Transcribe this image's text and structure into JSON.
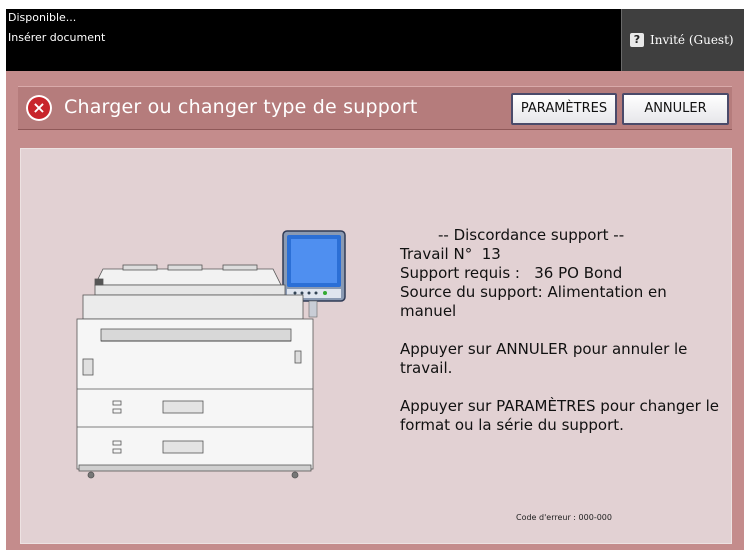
{
  "status": {
    "line1": "Disponible...",
    "line2": "Insérer document",
    "user_label": "Invité (Guest)",
    "user_icon": "?"
  },
  "dialog": {
    "title": "Charger ou changer type de support",
    "error_icon": "×",
    "params_button": "PARAMÈTRES",
    "cancel_button": "ANNULER"
  },
  "message": {
    "header": "-- Discordance support --",
    "job": "Travail N°  13",
    "required": "Support requis :   36 PO Bond",
    "source": "Source du support:   Alimentation en manuel",
    "cancel_hint": "  Appuyer sur ANNULER pour annuler le travail.",
    "params_hint": " Appuyer sur PARAMÈTRES pour changer le format ou la série du support."
  },
  "error_code": "Code d'erreur :  000-000",
  "colors": {
    "frame": "#c48c8c",
    "titlebar": "#b57c7c",
    "panel": "#e2d1d3",
    "error_red": "#c8242b"
  }
}
